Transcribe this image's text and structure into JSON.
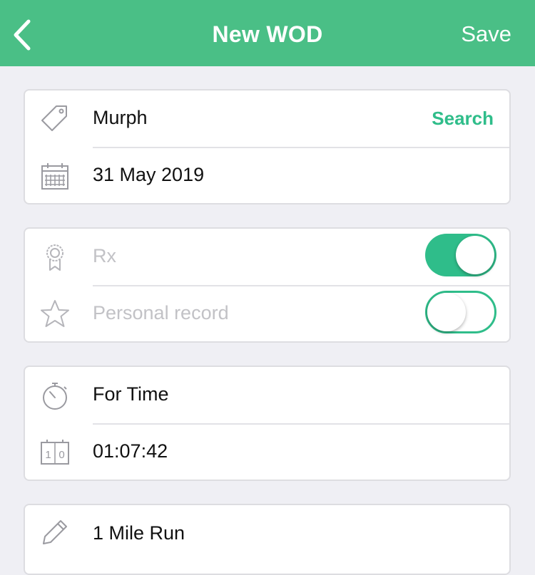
{
  "nav": {
    "back_icon": "chevron-left-icon",
    "title": "New WOD",
    "save_label": "Save"
  },
  "wod_info": {
    "name": "Murph",
    "search_label": "Search",
    "date": "31 May 2019"
  },
  "flags": {
    "rx_label": "Rx",
    "rx_on": true,
    "pr_label": "Personal record",
    "pr_on": false
  },
  "score": {
    "type": "For Time",
    "time": "01:07:42"
  },
  "movements": [
    {
      "label": "1 Mile Run"
    }
  ],
  "colors": {
    "header": "#4abf86",
    "accent": "#2fbd8a",
    "muted_text": "#c2c2c6"
  }
}
